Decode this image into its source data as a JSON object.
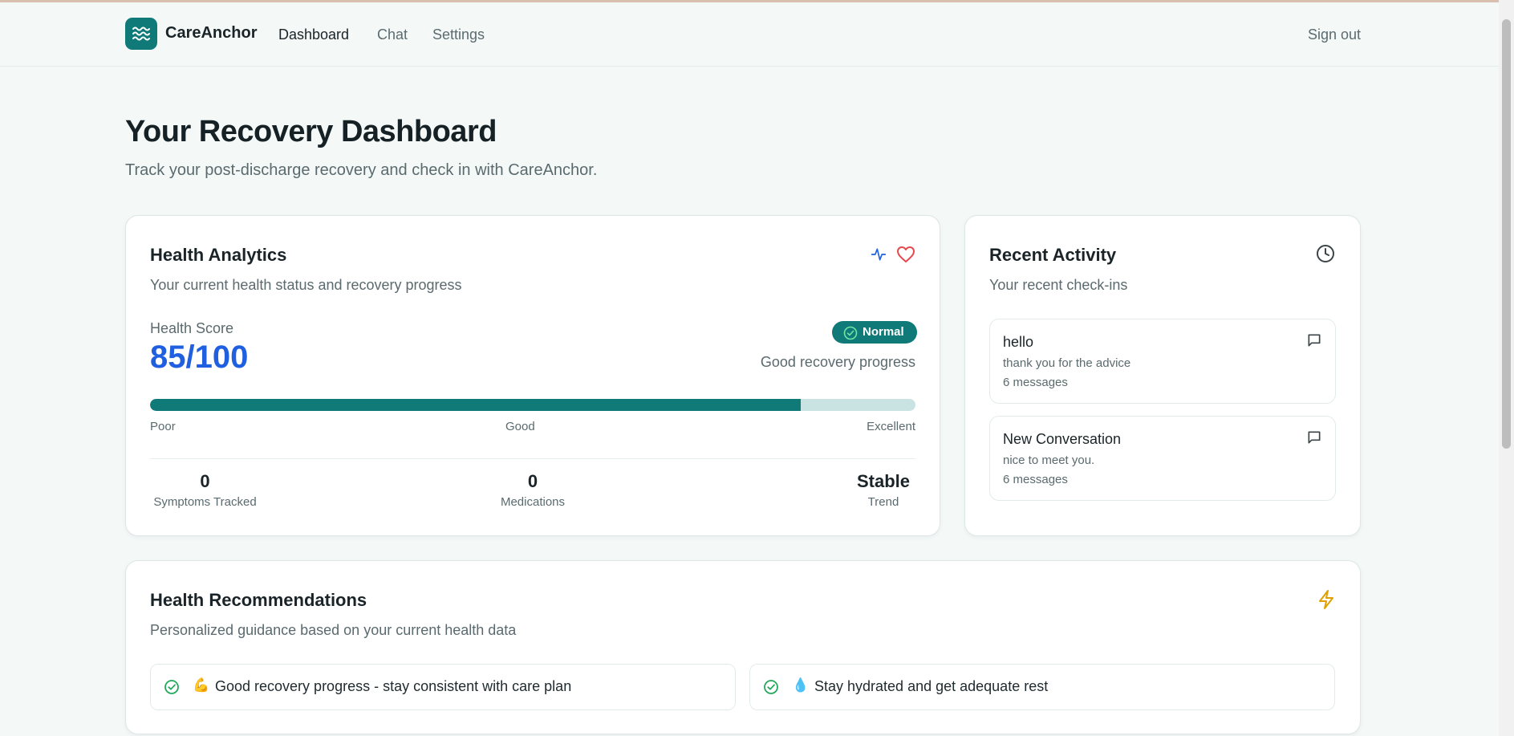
{
  "header": {
    "brand": "CareAnchor",
    "nav": [
      "Dashboard",
      "Chat",
      "Settings"
    ],
    "active_nav": "Dashboard",
    "sign_out": "Sign out"
  },
  "page": {
    "title": "Your Recovery Dashboard",
    "subtitle": "Track your post-discharge recovery and check in with CareAnchor."
  },
  "analytics": {
    "title": "Health Analytics",
    "subtitle": "Your current health status and recovery progress",
    "score_label": "Health Score",
    "score_value": "85/100",
    "score_fraction": 0.85,
    "status_badge": "Normal",
    "status_text": "Good recovery progress",
    "scale": [
      "Poor",
      "Good",
      "Excellent"
    ],
    "stats": [
      {
        "value": "0",
        "label": "Symptoms Tracked"
      },
      {
        "value": "0",
        "label": "Medications"
      },
      {
        "value": "Stable",
        "label": "Trend"
      }
    ]
  },
  "activity": {
    "title": "Recent Activity",
    "subtitle": "Your recent check-ins",
    "items": [
      {
        "title": "hello",
        "preview": "thank you for the advice",
        "count": "6 messages"
      },
      {
        "title": "New Conversation",
        "preview": "nice to meet you.",
        "count": "6 messages"
      }
    ]
  },
  "recommendations": {
    "title": "Health Recommendations",
    "subtitle": "Personalized guidance based on your current health data",
    "items": [
      {
        "emoji": "💪",
        "text": "Good recovery progress - stay consistent with care plan"
      },
      {
        "emoji": "💧",
        "text": "Stay hydrated and get adequate rest"
      }
    ]
  },
  "colors": {
    "accent": "#0f7a78",
    "score_blue": "#1f5fe0",
    "heart_red": "#e5484d",
    "bolt_yellow": "#e0a100"
  }
}
